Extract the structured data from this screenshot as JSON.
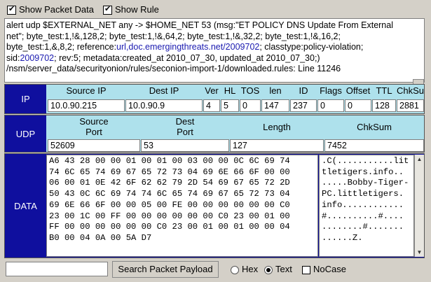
{
  "top_options": {
    "show_packet_data": {
      "label": "Show Packet Data",
      "checked": true
    },
    "show_rule": {
      "label": "Show Rule",
      "checked": true
    }
  },
  "rule": {
    "line1": "alert udp $EXTERNAL_NET any -> $HOME_NET 53 (msg:\"ET POLICY DNS Update From External",
    "line2": "net\"; byte_test:1,!&,128,2; byte_test:1,!&,64,2; byte_test:1,!&,32,2; byte_test:1,!&,16,2;",
    "line3_pre": "byte_test:1,&,8,2; reference:",
    "line3_link": "url,doc.emergingthreats.net/2009702",
    "line3_post": "; classtype:policy-violation;",
    "line4_pre": "sid:",
    "line4_link": "2009702",
    "line4_post": "; rev:5; metadata:created_at 2010_07_30, updated_at 2010_07_30;)",
    "line5": "/nsm/server_data/securityonion/rules/seconion-import-1/downloaded.rules: Line 11246"
  },
  "ip": {
    "label": "IP",
    "headers": {
      "src": "Source IP",
      "dst": "Dest IP",
      "ver": "Ver",
      "hl": "HL",
      "tos": "TOS",
      "len": "len",
      "id": "ID",
      "flags": "Flags",
      "offset": "Offset",
      "ttl": "TTL",
      "chksum": "ChkSum"
    },
    "values": {
      "src": "10.0.90.215",
      "dst": "10.0.90.9",
      "ver": "4",
      "hl": "5",
      "tos": "0",
      "len": "147",
      "id": "237",
      "flags": "0",
      "offset": "0",
      "ttl": "128",
      "chksum": "2881"
    }
  },
  "udp": {
    "label": "UDP",
    "headers": {
      "src_port": "Source\nPort",
      "dst_port": "Dest\nPort",
      "length": "Length",
      "chksum": "ChkSum"
    },
    "values": {
      "src_port": "52609",
      "dst_port": "53",
      "length": "127",
      "chksum": "7452"
    }
  },
  "data": {
    "label": "DATA",
    "hex": "A6 43 28 00 00 01 00 01 00 03 00 00 0C 6C 69 74\n74 6C 65 74 69 67 65 72 73 04 69 6E 66 6F 00 00\n06 00 01 0E 42 6F 62 62 79 2D 54 69 67 65 72 2D\n50 43 0C 6C 69 74 74 6C 65 74 69 67 65 72 73 04\n69 6E 66 6F 00 00 05 00 FE 00 00 00 00 00 00 C0\n23 00 1C 00 FF 00 00 00 00 00 00 C0 23 00 01 00\nFF 00 00 00 00 00 00 C0 23 00 01 00 01 00 00 04\nB0 00 04 0A 00 5A D7",
    "ascii": ".C(...........lit\ntletigers.info..\n.....Bobby-Tiger-\nPC.littletigers.\ninfo............\n#..........#....\n........#.......\n......Z."
  },
  "search": {
    "input_value": "",
    "button_label": "Search Packet Payload",
    "hex_label": "Hex",
    "text_label": "Text",
    "nocase_label": "NoCase",
    "mode": "Text",
    "nocase": false
  }
}
